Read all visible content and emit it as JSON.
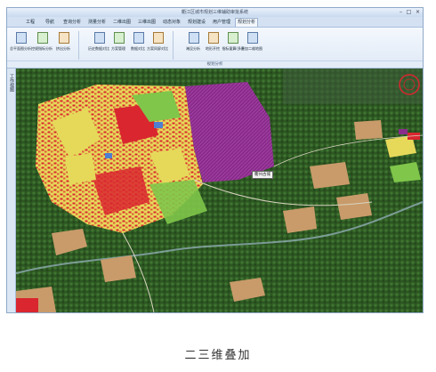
{
  "window": {
    "title": "衢江区城市规划三维辅助审批系统"
  },
  "menu": {
    "tabs": [
      {
        "label": "工程",
        "active": false
      },
      {
        "label": "导航",
        "active": false
      },
      {
        "label": "查询分析",
        "active": false
      },
      {
        "label": "测量分析",
        "active": false
      },
      {
        "label": "二维出图",
        "active": false
      },
      {
        "label": "三维出图",
        "active": false
      },
      {
        "label": "动态对象",
        "active": false
      },
      {
        "label": "规划建设",
        "active": false
      },
      {
        "label": "用户管理",
        "active": false
      },
      {
        "label": "规划分析",
        "active": true
      }
    ]
  },
  "ribbon": {
    "buttons": [
      {
        "label": "总平面图分析",
        "icon": "site-plan-icon"
      },
      {
        "label": "控规指标分析",
        "icon": "control-index-icon"
      },
      {
        "label": "挤出分析",
        "icon": "extrude-icon"
      },
      {
        "label": "历史数据对比",
        "icon": "history-compare-icon"
      },
      {
        "label": "方案管理",
        "icon": "plan-manage-icon"
      },
      {
        "label": "数据对比",
        "icon": "data-compare-icon"
      },
      {
        "label": "方案同屏对比",
        "icon": "split-screen-icon"
      },
      {
        "label": "淹没分析",
        "icon": "flood-icon"
      },
      {
        "label": "地形开挖",
        "icon": "terrain-cut-icon"
      },
      {
        "label": "指标量算(多)",
        "icon": "measure-icon"
      },
      {
        "label": "叠加二维地图",
        "icon": "overlay-2d-icon"
      }
    ],
    "group_label": "规划分析"
  },
  "left_pane": {
    "label": "工作视图"
  },
  "map": {
    "callout": "衢州古城"
  },
  "caption": "二三维叠加",
  "colors": {
    "residential": "#e6d95a",
    "commercial": "#d9262f",
    "public": "#4f7fd0",
    "green": "#7fc64a",
    "overlay": "#8a2c8c",
    "forest": "#2f5a25",
    "farmland": "#c99b6a"
  }
}
